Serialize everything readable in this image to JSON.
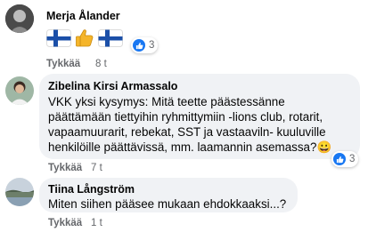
{
  "comments": [
    {
      "author": "Merja Ålander",
      "emoji_text": "🇫🇮👍🇫🇮",
      "reaction_count": "3",
      "action_label": "Tykkää",
      "timestamp": "8 t"
    },
    {
      "author": "Zibelina Kirsi Armassalo",
      "lines": [
        "VKK yksi kysymys: Mitä teette päästessänne",
        "päättämään tiettyihin ryhmittymiin -lions club, rotarit,",
        "vapaamuurarit, rebekat, SST ja vastaaviln- kuuluville",
        "henkilöille päättävissä, mm. laamannin asemassa?😀"
      ],
      "reaction_count": "3",
      "action_label": "Tykkää",
      "timestamp": "7 t"
    },
    {
      "author": "Tiina Långström",
      "text": "Miten siihen pääsee mukaan ehdokkaaksi...?",
      "action_label": "Tykkää",
      "timestamp": "1 t"
    }
  ],
  "colors": {
    "bubble": "#f0f2f5",
    "like_blue": "#1877f2",
    "meta_gray": "#65676b",
    "flag_blue": "#1b4fa8"
  },
  "icons": [
    "like-icon",
    "thumbs-up-emoji",
    "finland-flag-emoji",
    "grinning-emoji"
  ]
}
